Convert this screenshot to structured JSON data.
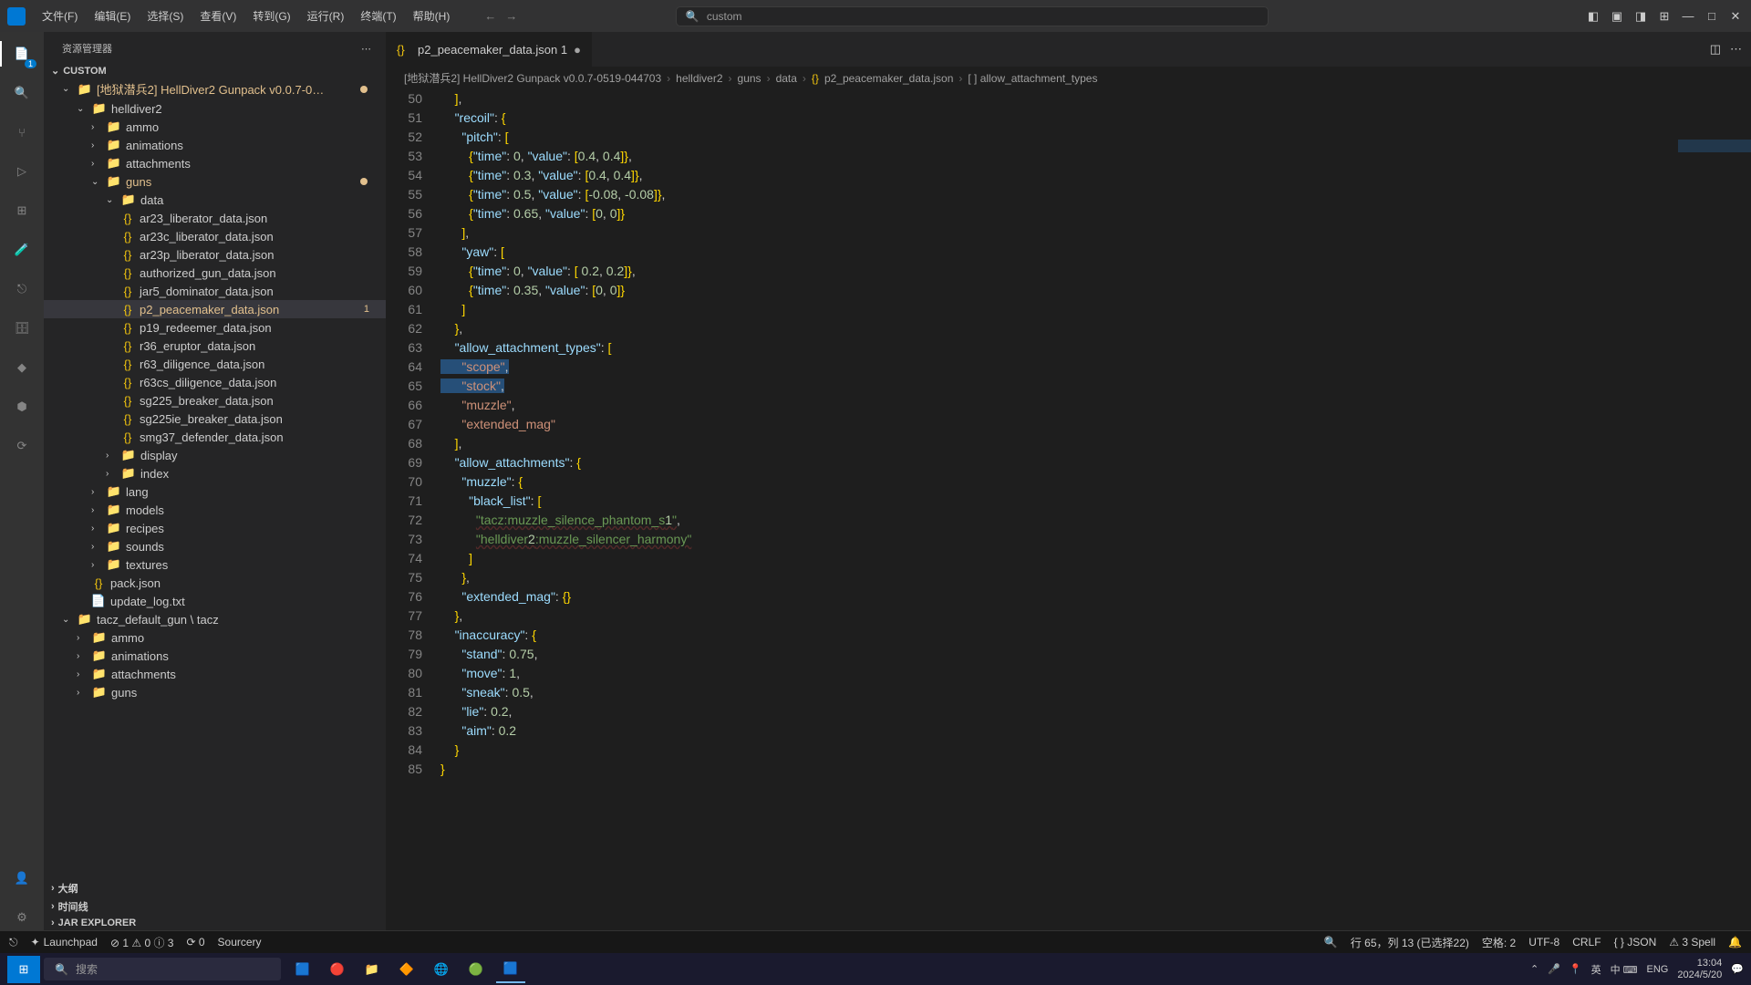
{
  "menu": [
    "文件(F)",
    "编辑(E)",
    "选择(S)",
    "查看(V)",
    "转到(G)",
    "运行(R)",
    "终端(T)",
    "帮助(H)"
  ],
  "search_value": "custom",
  "sidebar": {
    "title": "资源管理器",
    "root": "CUSTOM",
    "project": "[地狱潜兵2] HellDiver2 Gunpack v0.0.7-0…",
    "folders": {
      "helldiver2": "helldiver2",
      "ammo": "ammo",
      "animations": "animations",
      "attachments": "attachments",
      "guns": "guns",
      "data": "data",
      "display": "display",
      "index": "index",
      "lang": "lang",
      "models": "models",
      "recipes": "recipes",
      "sounds": "sounds",
      "textures": "textures",
      "tacz": "tacz_default_gun \\ tacz",
      "ammo2": "ammo",
      "animations2": "animations",
      "attachments2": "attachments",
      "guns2": "guns"
    },
    "files": {
      "ar23": "ar23_liberator_data.json",
      "ar23c": "ar23c_liberator_data.json",
      "ar23p": "ar23p_liberator_data.json",
      "auth": "authorized_gun_data.json",
      "jar5": "jar5_dominator_data.json",
      "p2": "p2_peacemaker_data.json",
      "p19": "p19_redeemer_data.json",
      "r36": "r36_eruptor_data.json",
      "r63": "r63_diligence_data.json",
      "r63cs": "r63cs_diligence_data.json",
      "sg225": "sg225_breaker_data.json",
      "sg225ie": "sg225ie_breaker_data.json",
      "smg37": "smg37_defender_data.json",
      "pack": "pack.json",
      "update": "update_log.txt"
    },
    "active_badge": "1",
    "sections": [
      "大纲",
      "时间线",
      "JAR EXPLORER"
    ]
  },
  "tab": {
    "name": "p2_peacemaker_data.json 1"
  },
  "breadcrumb": [
    "[地狱潜兵2] HellDiver2 Gunpack v0.0.7-0519-044703",
    "helldiver2",
    "guns",
    "data",
    "p2_peacemaker_data.json",
    "[ ] allow_attachment_types"
  ],
  "code": {
    "lines": [
      {
        "n": 50,
        "t": "    ],"
      },
      {
        "n": 51,
        "t": "    \"recoil\": {"
      },
      {
        "n": 52,
        "t": "      \"pitch\": ["
      },
      {
        "n": 53,
        "t": "        {\"time\": 0, \"value\": [0.4, 0.4]},"
      },
      {
        "n": 54,
        "t": "        {\"time\": 0.3, \"value\": [0.4, 0.4]},"
      },
      {
        "n": 55,
        "t": "        {\"time\": 0.5, \"value\": [-0.08, -0.08]},"
      },
      {
        "n": 56,
        "t": "        {\"time\": 0.65, \"value\": [0, 0]}"
      },
      {
        "n": 57,
        "t": "      ],"
      },
      {
        "n": 58,
        "t": "      \"yaw\": ["
      },
      {
        "n": 59,
        "t": "        {\"time\": 0, \"value\": [ 0.2, 0.2]},"
      },
      {
        "n": 60,
        "t": "        {\"time\": 0.35, \"value\": [0, 0]}"
      },
      {
        "n": 61,
        "t": "      ]"
      },
      {
        "n": 62,
        "t": "    },"
      },
      {
        "n": 63,
        "t": "    \"allow_attachment_types\": ["
      },
      {
        "n": 64,
        "t": "      \"scope\","
      },
      {
        "n": 65,
        "t": "      \"stock\","
      },
      {
        "n": 66,
        "t": "      \"muzzle\","
      },
      {
        "n": 67,
        "t": "      \"extended_mag\""
      },
      {
        "n": 68,
        "t": "    ],"
      },
      {
        "n": 69,
        "t": "    \"allow_attachments\": {"
      },
      {
        "n": 70,
        "t": "      \"muzzle\": {"
      },
      {
        "n": 71,
        "t": "        \"black_list\": ["
      },
      {
        "n": 72,
        "t": "          \"tacz:muzzle_silence_phantom_s1\","
      },
      {
        "n": 73,
        "t": "          \"helldiver2:muzzle_silencer_harmony\""
      },
      {
        "n": 74,
        "t": "        ]"
      },
      {
        "n": 75,
        "t": "      },"
      },
      {
        "n": 76,
        "t": "      \"extended_mag\": {}"
      },
      {
        "n": 77,
        "t": "    },"
      },
      {
        "n": 78,
        "t": "    \"inaccuracy\": {"
      },
      {
        "n": 79,
        "t": "      \"stand\": 0.75,"
      },
      {
        "n": 80,
        "t": "      \"move\": 1,"
      },
      {
        "n": 81,
        "t": "      \"sneak\": 0.5,"
      },
      {
        "n": 82,
        "t": "      \"lie\": 0.2,"
      },
      {
        "n": 83,
        "t": "      \"aim\": 0.2"
      },
      {
        "n": 84,
        "t": "    }"
      },
      {
        "n": 85,
        "t": "}"
      }
    ]
  },
  "status": {
    "launchpad": "Launchpad",
    "errors": "⊘ 1 ⚠ 0 ⓘ 3",
    "ports": "⟳ 0",
    "sourcery": "Sourcery",
    "position": "行 65，列 13 (已选择22)",
    "spaces": "空格: 2",
    "encoding": "UTF-8",
    "eol": "CRLF",
    "lang": "{ } JSON",
    "spell": "⚠ 3 Spell"
  },
  "taskbar": {
    "search": "搜索",
    "ime": "ENG",
    "lang2": "英",
    "conn": "中 ⌨",
    "time": "13:04",
    "date": "2024/5/20"
  }
}
